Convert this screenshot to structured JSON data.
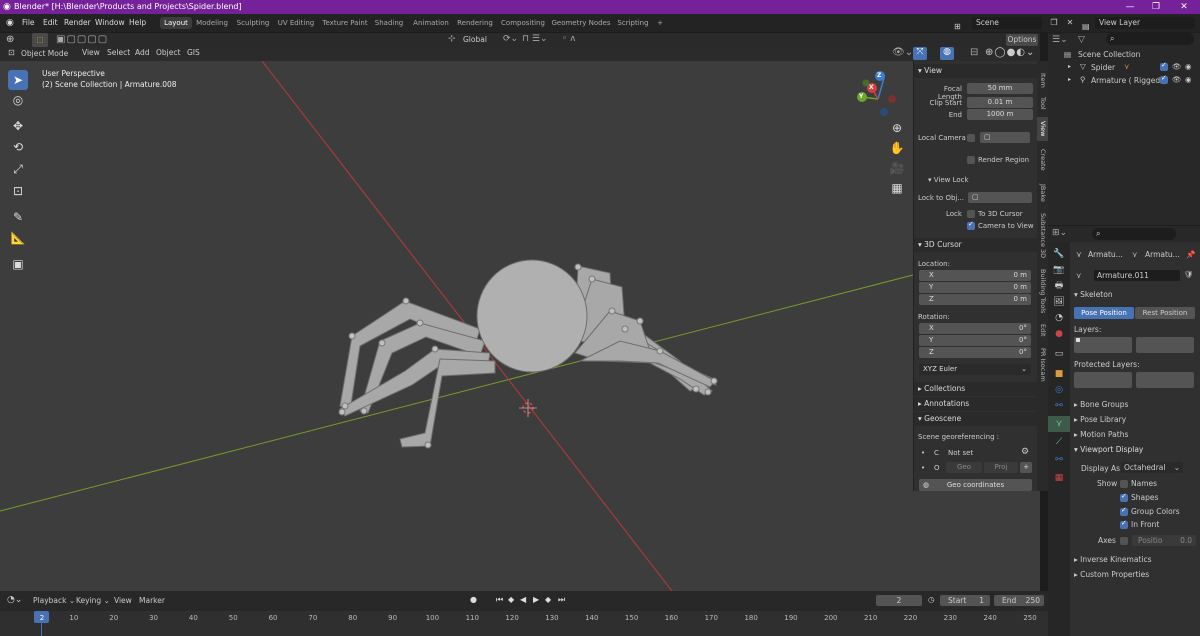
{
  "app": {
    "title": "Blender* [H:\\Blender\\Products and Projects\\Spider.blend]",
    "window_controls": [
      "—",
      "❐",
      "✕"
    ]
  },
  "menus": [
    "File",
    "Edit",
    "Render",
    "Window",
    "Help"
  ],
  "workspaces": [
    "Layout",
    "Modeling",
    "Sculpting",
    "UV Editing",
    "Texture Paint",
    "Shading",
    "Animation",
    "Rendering",
    "Compositing",
    "Geometry Nodes",
    "Scripting",
    "+"
  ],
  "scene": {
    "name": "Scene",
    "view_layer": "View Layer"
  },
  "viewport": {
    "mode": "Object Mode",
    "menu": [
      "View",
      "Select",
      "Add",
      "Object",
      "GIS"
    ],
    "orientation": "Global",
    "options": "Options",
    "overlay_title": "User Perspective",
    "overlay_sub": "(2) Scene Collection | Armature.008",
    "gizmo": {
      "x": "X",
      "y": "Y",
      "z": "Z"
    }
  },
  "npanel": {
    "view": {
      "title": "View",
      "focal_label": "Focal Length",
      "focal": "50 mm",
      "clip_start_label": "Clip Start",
      "clip_start": "0.01 m",
      "end_label": "End",
      "end": "1000 m",
      "local_camera": "Local Camera",
      "render_region": "Render Region"
    },
    "view_lock": {
      "title": "View Lock",
      "lock_obj": "Lock to Obj...",
      "lock": "Lock",
      "to_cursor": "To 3D Cursor",
      "camera_to_view": "Camera to View"
    },
    "cursor": {
      "title": "3D Cursor",
      "location": "Location:",
      "rotation": "Rotation:",
      "x": "X",
      "y": "Y",
      "z": "Z",
      "lx": "0 m",
      "ly": "0 m",
      "lz": "0 m",
      "rx": "0°",
      "ry": "0°",
      "rz": "0°",
      "euler": "XYZ Euler"
    },
    "collections": "Collections",
    "annotations": "Annotations",
    "geoscene": "Geoscene",
    "georef": "Scene georeferencing :",
    "c": "C",
    "not_set": "Not set",
    "o": "O",
    "geo": "Geo",
    "proj": "Proj",
    "geo_coords": "Geo coordinates"
  },
  "vtabs": [
    "Item",
    "Tool",
    "View",
    "Create",
    "JBake",
    "Substance 3D",
    "Building Tools",
    "Edit",
    "PR Isocam"
  ],
  "outliner": {
    "root": "Scene Collection",
    "items": [
      "Spider",
      "Armature ( Rigged )"
    ]
  },
  "props": {
    "obj1": "Armatu...",
    "obj2": "Armatu...",
    "data_name": "Armature.011",
    "skeleton": "Skeleton",
    "pose_position": "Pose Position",
    "rest_position": "Rest Position",
    "layers": "Layers:",
    "protected_layers": "Protected Layers:",
    "bone_groups": "Bone Groups",
    "pose_library": "Pose Library",
    "motion_paths": "Motion Paths",
    "viewport_display": "Viewport Display",
    "display_as_label": "Display As",
    "display_as": "Octahedral",
    "show": "Show",
    "names": "Names",
    "shapes": "Shapes",
    "group_colors": "Group Colors",
    "in_front": "In Front",
    "axes": "Axes",
    "position": "Positio",
    "position_val": "0.0",
    "inverse_kinematics": "Inverse Kinematics",
    "custom_properties": "Custom Properties"
  },
  "timeline": {
    "menu": [
      "Playback",
      "Keying",
      "View",
      "Marker"
    ],
    "current": "2",
    "start_label": "Start",
    "start": "1",
    "end_label": "End",
    "end": "250",
    "ticks": [
      "2",
      "10",
      "20",
      "30",
      "40",
      "50",
      "60",
      "70",
      "80",
      "90",
      "100",
      "110",
      "120",
      "130",
      "140",
      "150",
      "160",
      "170",
      "180",
      "190",
      "200",
      "210",
      "220",
      "230",
      "240",
      "250"
    ]
  },
  "colors": {
    "accent": "#4772b3",
    "title_bar": "#75229a",
    "viewport": "#3d3d3d",
    "x_axis": "#b83a3a",
    "y_axis": "#7a9a2a"
  }
}
